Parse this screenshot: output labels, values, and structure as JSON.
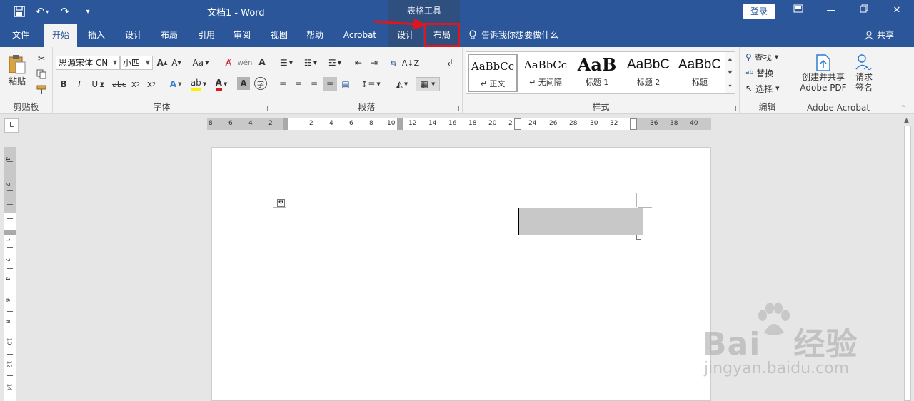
{
  "titlebar": {
    "doc_title": "文档1  -  Word",
    "context_header": "表格工具",
    "login": "登录"
  },
  "tabs": [
    {
      "label": "文件"
    },
    {
      "label": "开始"
    },
    {
      "label": "插入"
    },
    {
      "label": "设计"
    },
    {
      "label": "布局"
    },
    {
      "label": "引用"
    },
    {
      "label": "审阅"
    },
    {
      "label": "视图"
    },
    {
      "label": "帮助"
    },
    {
      "label": "Acrobat"
    },
    {
      "label": "设计"
    },
    {
      "label": "布局"
    }
  ],
  "tell_me": "告诉我你想要做什么",
  "share": "共享",
  "ribbon": {
    "clipboard": {
      "paste": "粘贴",
      "label": "剪贴板"
    },
    "font": {
      "font_name": "思源宋体 CN",
      "font_size": "小四",
      "label": "字体",
      "aa": "Aa"
    },
    "paragraph": {
      "label": "段落"
    },
    "styles": {
      "label": "样式",
      "items": [
        {
          "sample": "AaBbCc",
          "name": "↵ 正文"
        },
        {
          "sample": "AaBbCc",
          "name": "↵ 无间隔"
        },
        {
          "sample": "AaB",
          "name": "标题 1"
        },
        {
          "sample": "AaBbC",
          "name": "标题 2"
        },
        {
          "sample": "AaBbC",
          "name": "标题"
        }
      ]
    },
    "editing": {
      "find": "查找",
      "replace": "替换",
      "select": "选择",
      "label": "编辑"
    },
    "acrobat": {
      "create": "创建并共享",
      "create2": "Adobe PDF",
      "sign": "请求",
      "sign2": "签名",
      "label": "Adobe Acrobat"
    }
  },
  "ruler": {
    "h_labels": [
      "8",
      "6",
      "4",
      "2",
      "2",
      "4",
      "6",
      "8",
      "10",
      "12",
      "14",
      "16",
      "18",
      "20",
      "2",
      "24",
      "26",
      "28",
      "30",
      "32",
      "36",
      "38",
      "40"
    ],
    "v_labels": [
      "4",
      "2",
      "1",
      "2",
      "4",
      "6",
      "8",
      "10",
      "12",
      "14"
    ]
  },
  "watermark": {
    "brand": "Bai",
    "suffix": "经验",
    "url": "jingyan.baidu.com"
  },
  "colors": {
    "accent": "#2b579a",
    "highlight_box": "#e0151f",
    "arrow": "#e0151f"
  }
}
